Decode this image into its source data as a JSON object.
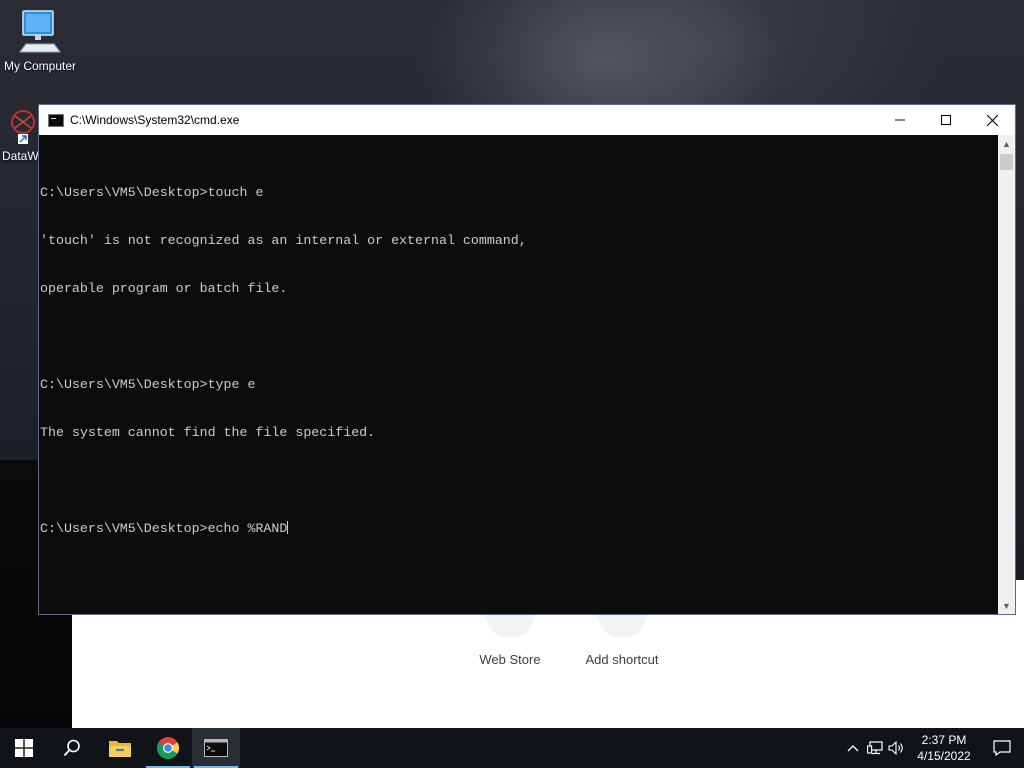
{
  "desktop": {
    "icons": [
      {
        "label": "My Computer"
      },
      {
        "label": "DataW"
      }
    ]
  },
  "chrome_background": {
    "tiles": [
      {
        "label": "Web Store"
      },
      {
        "label": "Add shortcut"
      }
    ]
  },
  "cmd_window": {
    "title": "C:\\Windows\\System32\\cmd.exe",
    "minimize_glyph": "—",
    "maximize_glyph": "☐",
    "close_glyph": "✕",
    "lines": [
      "C:\\Users\\VM5\\Desktop>touch e",
      "'touch' is not recognized as an internal or external command,",
      "operable program or batch file.",
      "",
      "C:\\Users\\VM5\\Desktop>type e",
      "The system cannot find the file specified.",
      "",
      "C:\\Users\\VM5\\Desktop>echo %RAND"
    ],
    "scroll_up_glyph": "▲",
    "scroll_down_glyph": "▼"
  },
  "taskbar": {
    "items": [
      {
        "name": "start",
        "icon": "windows-logo-icon"
      },
      {
        "name": "search",
        "icon": "search-icon"
      },
      {
        "name": "file-explorer",
        "icon": "folder-icon"
      },
      {
        "name": "chrome",
        "icon": "chrome-icon"
      },
      {
        "name": "command-prompt",
        "icon": "cmd-icon",
        "active": true
      }
    ],
    "tray": {
      "chevron_glyph": "⌃",
      "clock_time": "2:37 PM",
      "clock_date": "4/15/2022"
    }
  },
  "colors": {
    "console_bg": "#0c0c0c",
    "console_fg": "#cccccc",
    "taskbar_bg": "#101418",
    "accent": "#76b9ed"
  }
}
